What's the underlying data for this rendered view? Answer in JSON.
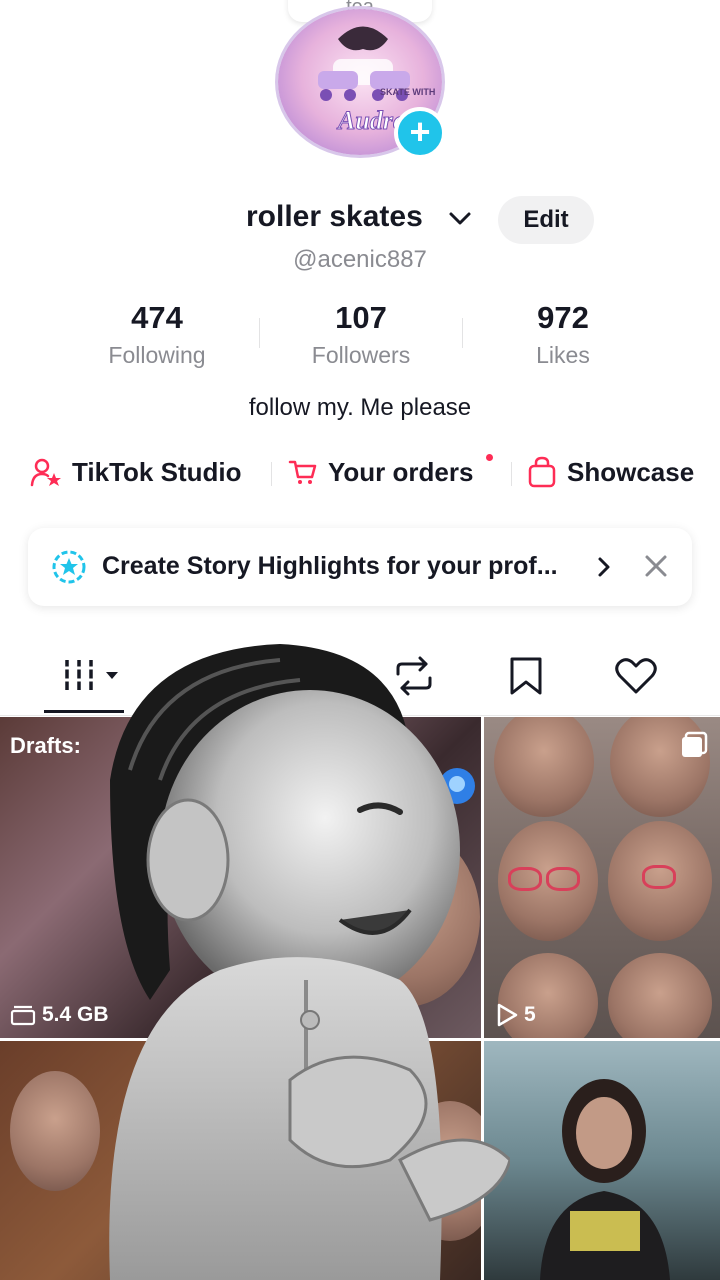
{
  "note": {
    "text": "tea"
  },
  "profile": {
    "avatar_text_top": "SKATE WITH",
    "avatar_text_bottom": "Audrey",
    "display_name": "roller skates",
    "edit_label": "Edit",
    "username": "@acenic887",
    "bio": "follow my. Me please"
  },
  "stats": [
    {
      "value": "474",
      "label": "Following"
    },
    {
      "value": "107",
      "label": "Followers"
    },
    {
      "value": "972",
      "label": "Likes"
    }
  ],
  "links": {
    "studio": "TikTok Studio",
    "orders": "Your orders",
    "showcase": "Showcase"
  },
  "highlight_banner": {
    "text": "Create Story Highlights for your prof..."
  },
  "grid": {
    "drafts_label": "Drafts:",
    "storage": "5.4 GB",
    "play_count": "5"
  },
  "colors": {
    "accent": "#fe2c55",
    "blue": "#20c4ea",
    "text_primary": "#161823",
    "text_secondary": "#8a8b91"
  }
}
